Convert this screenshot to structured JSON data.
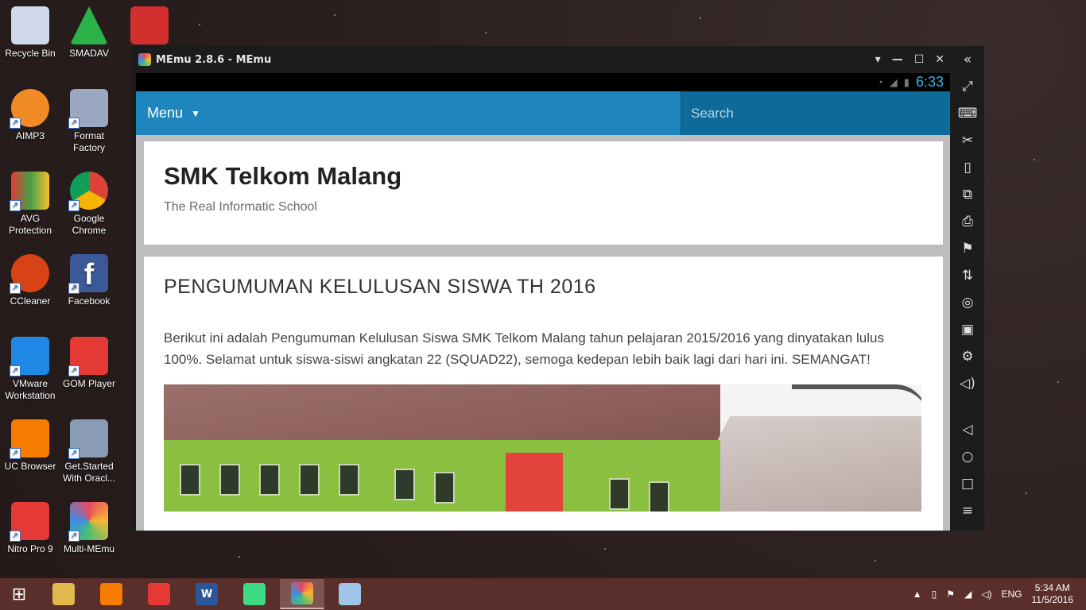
{
  "desktop": {
    "icons": [
      {
        "label": "Recycle Bin",
        "color": "#cfd8e8"
      },
      {
        "label": "SMADAV",
        "color": "#2bb34a"
      },
      {
        "label": "AIMP3",
        "color": "#f08a24"
      },
      {
        "label": "Format Factory",
        "color": "#9aa8c2"
      },
      {
        "label": "AVG Protection",
        "color": "#e53935"
      },
      {
        "label": "Google Chrome",
        "color": "#4caf50"
      },
      {
        "label": "CCleaner",
        "color": "#d84315"
      },
      {
        "label": "Facebook",
        "color": "#3b5998"
      },
      {
        "label": "VMware Workstation",
        "color": "#1e88e5"
      },
      {
        "label": "GOM Player",
        "color": "#e53935"
      },
      {
        "label": "UC Browser",
        "color": "#f57c00"
      },
      {
        "label": "Get.Started With Oracl...",
        "color": "#8a9bb5"
      },
      {
        "label": "Nitro Pro 9",
        "color": "#e53935"
      },
      {
        "label": "Multi-MEmu",
        "color": "#ffffff"
      }
    ]
  },
  "memu": {
    "title": "MEmu 2.8.6 - MEmu",
    "controls": [
      "▾",
      "—",
      "☐",
      "✕"
    ],
    "collapse_icon": "«"
  },
  "android": {
    "status_time": "6:33",
    "nav": {
      "menu_label": "Menu",
      "search_placeholder": "Search"
    },
    "site": {
      "title": "SMK Telkom Malang",
      "description": "The Real Informatic School"
    },
    "post": {
      "title": "PENGUMUMAN KELULUSAN SISWA TH 2016",
      "body": "Berikut ini adalah Pengumuman Kelulusan Siswa SMK Telkom Malang tahun pelajaran 2015/2016 yang dinyatakan lulus 100%. Selamat untuk siswa-siswi angkatan 22 (SQUAD22), semoga kedepan lebih baik lagi dari hari ini. SEMANGAT!"
    }
  },
  "sidebar_tools": [
    "fullscreen-icon",
    "keyboard-icon",
    "scissors-icon",
    "shake-icon",
    "rotate-icon",
    "apk-icon",
    "broom-icon",
    "transfer-icon",
    "mouse-icon",
    "record-icon",
    "settings-icon",
    "volume-icon",
    "back-icon",
    "home-icon",
    "recents-icon",
    "menu-icon"
  ],
  "taskbar": {
    "apps": [
      "file-explorer",
      "uc-browser",
      "gom-player",
      "word",
      "android-studio",
      "memu",
      "paint"
    ],
    "language": "ENG",
    "time": "5:34 AM",
    "date": "11/5/2016"
  }
}
